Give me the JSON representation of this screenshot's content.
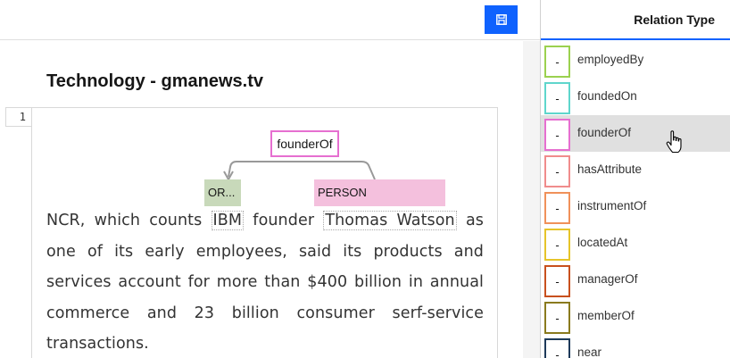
{
  "toolbar": {
    "save_icon": "save-icon"
  },
  "document": {
    "title": "Technology - gmanews.tv",
    "line_number": "1",
    "relation_label": "founderOf",
    "entities": {
      "org_label": "OR...",
      "person_label": "PERSON"
    },
    "text": {
      "pre": "NCR, which counts ",
      "org": "IBM",
      "mid": " founder ",
      "person": "Thomas Watson",
      "post": " as one of its early employees, said its products and services account for more than $400 billion in annual  commerce and 23 billion consumer serf-service transactions."
    },
    "colors": {
      "org": "#c8d9ba",
      "person": "#f4c0dd",
      "relation": "#e66fd0",
      "arrow": "#999999"
    }
  },
  "panel": {
    "title": "Relation Type",
    "items": [
      {
        "label": "employedBy",
        "key": "-",
        "color": "#9bd14f"
      },
      {
        "label": "foundedOn",
        "key": "-",
        "color": "#5fd6cc"
      },
      {
        "label": "founderOf",
        "key": "-",
        "color": "#e66fd0"
      },
      {
        "label": "hasAttribute",
        "key": "-",
        "color": "#f08c8c"
      },
      {
        "label": "instrumentOf",
        "key": "-",
        "color": "#f0915a"
      },
      {
        "label": "locatedAt",
        "key": "-",
        "color": "#e6c42a"
      },
      {
        "label": "managerOf",
        "key": "-",
        "color": "#c8501e"
      },
      {
        "label": "memberOf",
        "key": "-",
        "color": "#8a7a1e"
      },
      {
        "label": "near",
        "key": "-",
        "color": "#1e3a5a"
      }
    ],
    "hovered_item": "founderOf",
    "accent": "#0f62fe"
  }
}
